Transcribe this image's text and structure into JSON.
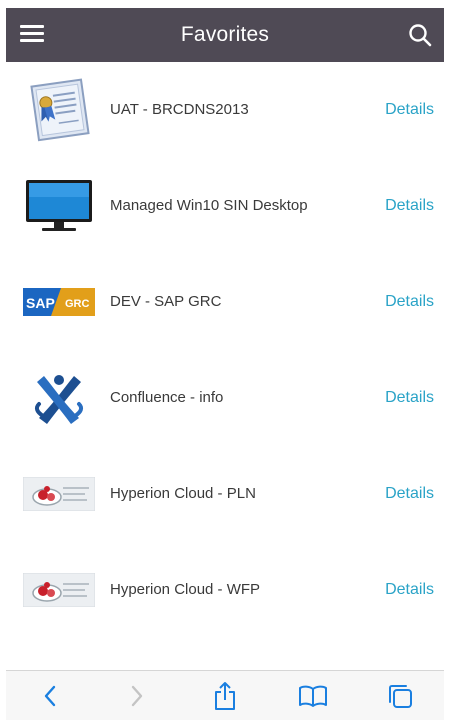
{
  "header": {
    "title": "Favorites",
    "menu_icon": "hamburger-menu-icon",
    "search_icon": "search-icon"
  },
  "favorites": [
    {
      "label": "UAT - BRCDNS2013",
      "icon": "certificate-icon",
      "action": "Details"
    },
    {
      "label": "Managed Win10 SIN Desktop",
      "icon": "monitor-icon",
      "action": "Details"
    },
    {
      "label": "DEV - SAP GRC",
      "icon": "sap-grc-logo",
      "logo_text_left": "SAP",
      "logo_text_right": "GRC",
      "action": "Details"
    },
    {
      "label": "Confluence - info",
      "icon": "confluence-logo",
      "action": "Details"
    },
    {
      "label": "Hyperion Cloud - PLN",
      "icon": "hyperion-cloud-icon",
      "action": "Details"
    },
    {
      "label": "Hyperion Cloud - WFP",
      "icon": "hyperion-cloud-icon",
      "action": "Details"
    }
  ],
  "toolbar": {
    "icons": [
      "back-icon",
      "forward-icon",
      "share-icon",
      "bookmarks-icon",
      "tabs-icon"
    ]
  },
  "colors": {
    "header_bg": "#4f4a55",
    "link": "#2aa3c7",
    "toolbar_icon": "#1a7fe0",
    "toolbar_icon_disabled": "#c4c4c4"
  }
}
